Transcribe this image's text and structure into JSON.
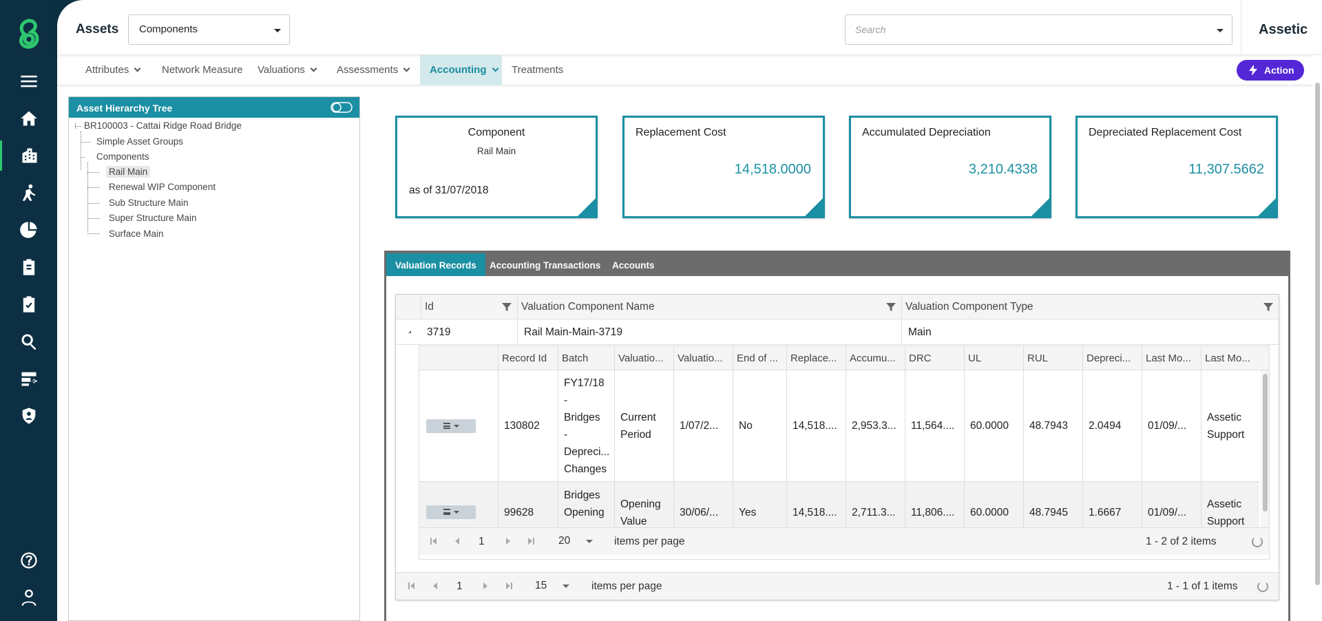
{
  "header": {
    "title": "Assets",
    "module_select": "Components",
    "search_placeholder": "Search",
    "brand": "Assetic"
  },
  "subnav": {
    "items": [
      {
        "label": "Attributes",
        "has_menu": true
      },
      {
        "label": "Network Measure",
        "has_menu": false
      },
      {
        "label": "Valuations",
        "has_menu": true
      },
      {
        "label": "Assessments",
        "has_menu": true
      },
      {
        "label": "Accounting",
        "has_menu": true,
        "active": true
      },
      {
        "label": "Treatments",
        "has_menu": false
      }
    ],
    "action_label": "Action"
  },
  "rail": {
    "icons": [
      "menu-icon",
      "home-icon",
      "building-icon",
      "worker-icon",
      "finance-icon",
      "clipboard-icon",
      "checklist-icon",
      "search-icon",
      "data-import-icon",
      "shield-icon",
      "help-icon",
      "user-icon"
    ],
    "active": "building-icon"
  },
  "tree": {
    "title": "Asset Hierarchy Tree",
    "root": "BR100003 - Cattai Ridge Road Bridge",
    "groups": "Simple Asset Groups",
    "components": "Components",
    "children": [
      "Rail Main",
      "Renewal WIP Component",
      "Sub Structure Main",
      "Super Structure Main",
      "Surface Main"
    ],
    "selected": "Rail Main"
  },
  "cards": {
    "component_title": "Component",
    "component_name": "Rail Main",
    "as_of": "as of 31/07/2018",
    "replacement_title": "Replacement Cost",
    "replacement_value": "14,518.0000",
    "accum_title": "Accumulated Depreciation",
    "accum_value": "3,210.4338",
    "drc_title": "Depreciated Replacement Cost",
    "drc_value": "11,307.5662"
  },
  "tabs": [
    "Valuation Records",
    "Accounting Transactions",
    "Accounts"
  ],
  "grid": {
    "columns": [
      "Id",
      "Valuation Component Name",
      "Valuation Component Type"
    ],
    "row": {
      "id": "3719",
      "name": "Rail Main-Main-3719",
      "type": "Main"
    },
    "inner_columns": [
      "Record Id",
      "Batch",
      "Valuatio...",
      "Valuatio...",
      "End of ...",
      "Replace...",
      "Accumu...",
      "DRC",
      "UL",
      "RUL",
      "Depreci...",
      "Last Mo...",
      "Last Mo..."
    ],
    "inner_rows": [
      {
        "record_id": "130802",
        "batch": [
          "FY17/18",
          "-",
          "Bridges",
          "-",
          "Depreci...",
          "Changes"
        ],
        "type": [
          "Current",
          "Period"
        ],
        "date": "1/07/2...",
        "end": "No",
        "replace": "14,518....",
        "accum": "2,953.3...",
        "drc": "11,564....",
        "ul": "60.0000",
        "rul": "48.7943",
        "dep": "2.0494",
        "lastmod": "01/09/...",
        "lastby": [
          "Assetic",
          "Support"
        ]
      },
      {
        "record_id": "99628",
        "batch": [
          "Bridges",
          "Opening"
        ],
        "type": [
          "Opening",
          "Value"
        ],
        "date": "30/06/...",
        "end": "Yes",
        "replace": "14,518....",
        "accum": "2,711.3...",
        "drc": "11,806....",
        "ul": "60.0000",
        "rul": "48.7945",
        "dep": "1.6667",
        "lastmod": "01/09/...",
        "lastby": [
          "Assetic",
          "Support"
        ]
      }
    ],
    "inner_pager": {
      "page": "1",
      "size": "20",
      "ipp": "items per page",
      "info": "1 - 2 of 2 items"
    },
    "outer_pager": {
      "page": "1",
      "size": "15",
      "ipp": "items per page",
      "info": "1 - 1 of 1 items"
    }
  },
  "colors": {
    "rail": "#0d2f43",
    "accent": "#1b8fa3",
    "action": "#5326d6",
    "brand_green": "#2ec76e"
  }
}
